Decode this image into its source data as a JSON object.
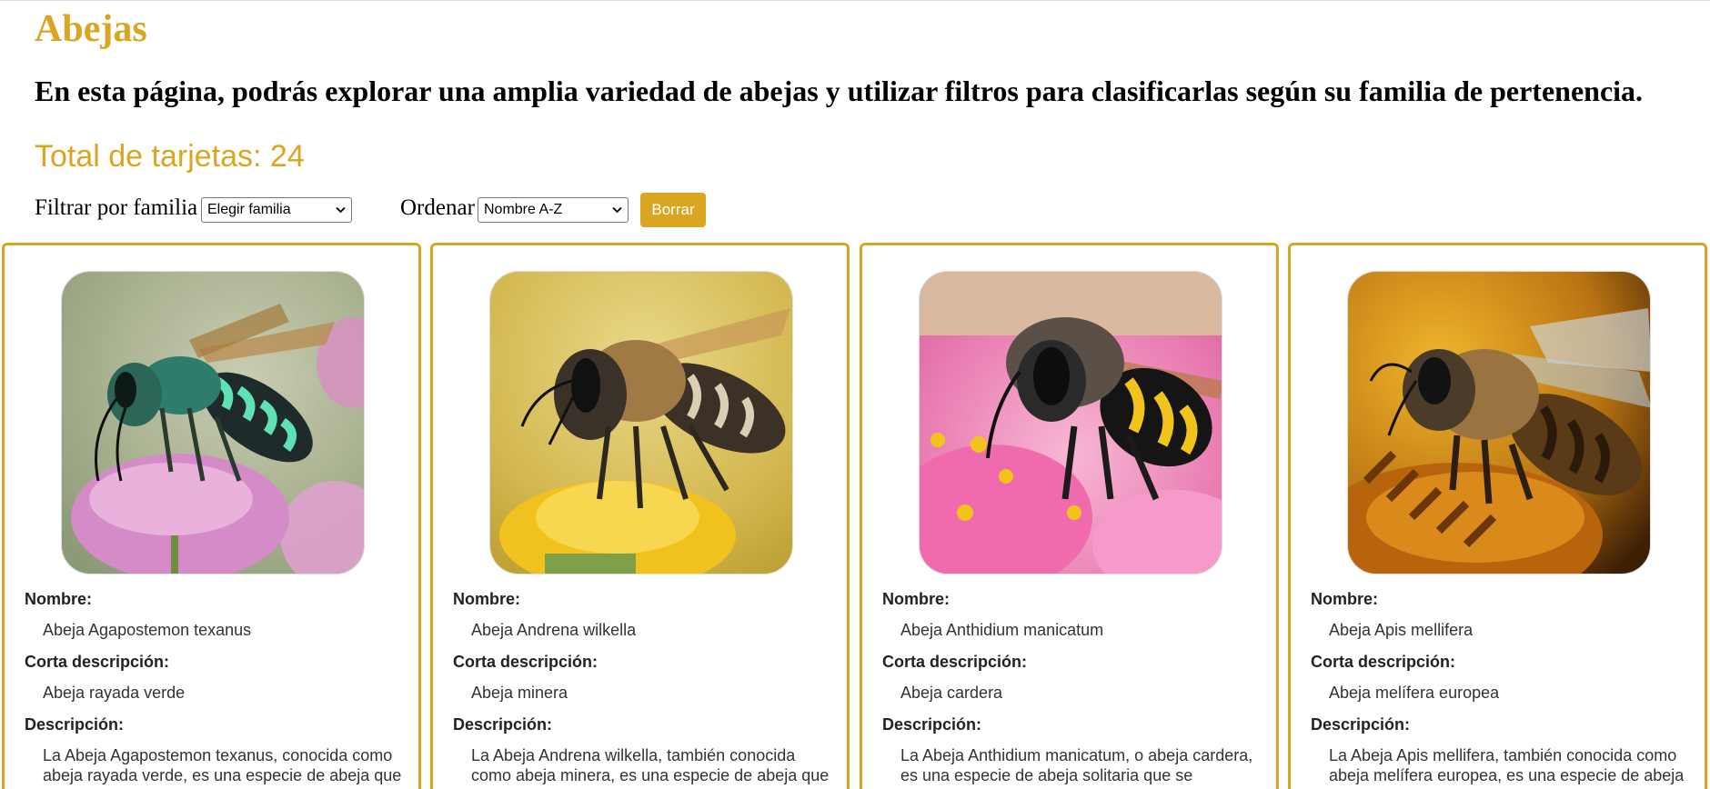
{
  "page": {
    "title": "Abejas",
    "subtitle": "En esta página, podrás explorar una amplia variedad de abejas y utilizar filtros para clasificarlas según su familia de pertenencia.",
    "total": "Total de tarjetas: 24"
  },
  "controls": {
    "filter_label": "Filtrar por familia",
    "filter_value": "Elegir familia",
    "sort_label": "Ordenar",
    "sort_value": "Nombre A-Z",
    "clear_label": "Borrar"
  },
  "labels": {
    "name": "Nombre:",
    "short": "Corta descripción:",
    "desc": "Descripción:"
  },
  "cards": [
    {
      "name": "Abeja Agapostemon texanus",
      "short": "Abeja rayada verde",
      "desc": "La Abeja Agapostemon texanus, conocida como abeja rayada verde, es una especie de abeja que"
    },
    {
      "name": "Abeja Andrena wilkella",
      "short": "Abeja minera",
      "desc": "La Abeja Andrena wilkella, también conocida como abeja minera, es una especie de abeja que"
    },
    {
      "name": "Abeja Anthidium manicatum",
      "short": "Abeja cardera",
      "desc": "La Abeja Anthidium manicatum, o abeja cardera, es una especie de abeja solitaria que se"
    },
    {
      "name": "Abeja Apis mellifera",
      "short": "Abeja melífera europea",
      "desc": "La Abeja Apis mellifera, también conocida como abeja melífera europea, es una especie de abeja"
    }
  ],
  "colors": {
    "accent": "#DAA520"
  }
}
